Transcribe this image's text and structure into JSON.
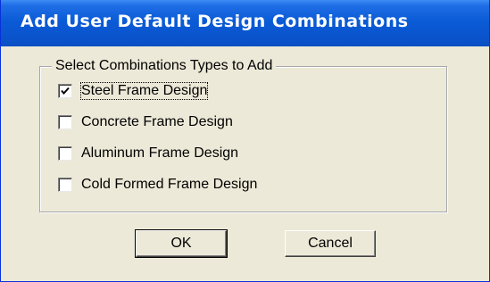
{
  "window": {
    "title": "Add User Default Design Combinations"
  },
  "group": {
    "legend": "Select Combinations Types to Add",
    "options": [
      {
        "label": "Steel Frame Design",
        "checked": true
      },
      {
        "label": "Concrete Frame Design",
        "checked": false
      },
      {
        "label": "Aluminum Frame Design",
        "checked": false
      },
      {
        "label": "Cold Formed Frame Design",
        "checked": false
      }
    ]
  },
  "buttons": {
    "ok_label": "OK",
    "cancel_label": "Cancel"
  },
  "colors": {
    "titlebar": "#0a56d0",
    "dialog_face": "#ece9d8"
  },
  "icons": {
    "checkmark": "checkmark-icon"
  }
}
